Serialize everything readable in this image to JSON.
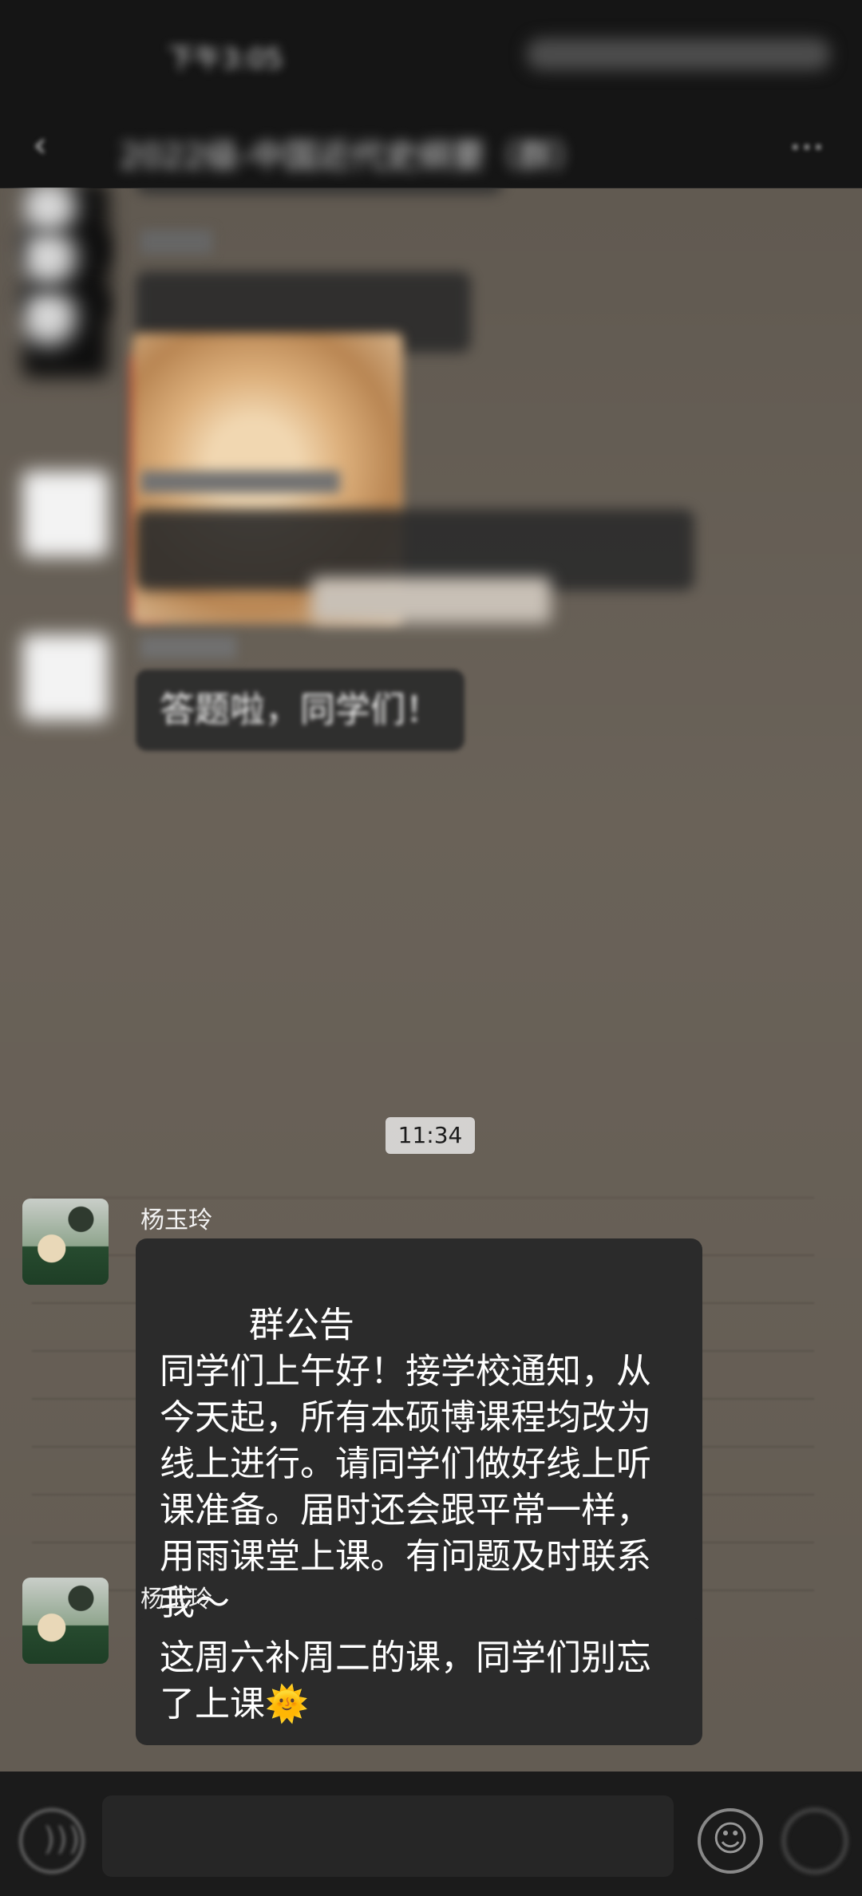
{
  "header": {
    "status_time": "下午3:05",
    "title": "2022级-中国近代史纲要（群）",
    "back_icon": "arrow-left-icon",
    "more_icon": "more-dots-icon"
  },
  "messages": [
    {
      "name": "",
      "text": "",
      "avatar": "dark"
    },
    {
      "name": "",
      "text": "",
      "avatar": "dark"
    },
    {
      "name": "",
      "text": "",
      "avatar": "white"
    },
    {
      "name": "",
      "text": "答题啦，同学们！",
      "avatar": "white"
    },
    {
      "name": "杨玉玲",
      "text": "群公告\n同学们上午好！接学校通知，从今天起，所有本硕博课程均改为线上进行。请同学们做好线上听课准备。届时还会跟平常一样，用雨课堂上课。有问题及时联系我～",
      "avatar": "photo"
    },
    {
      "name": "杨玉玲",
      "text": "这周六补周二的课，同学们别忘了上课🌞",
      "avatar": "photo"
    }
  ],
  "timestamp": "11:34",
  "composer": {
    "placeholder": "",
    "voice_icon": "voice-icon",
    "emoji_icon": "emoji-icon",
    "plus_icon": "plus-icon"
  }
}
